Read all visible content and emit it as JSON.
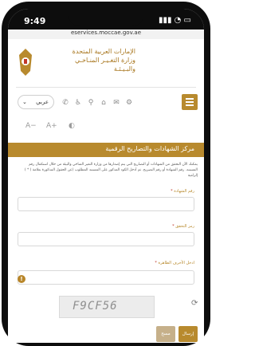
{
  "status_bar": {
    "time": "9:49",
    "url": "eservices.moccae.gov.ae"
  },
  "header": {
    "ministry_line1": "الإمارات العربية المتحدة",
    "ministry_line2": "وزارة التغـيـر المنـاخـي",
    "ministry_line3": "والبـيـئـة"
  },
  "toolbar": {
    "language": "عربي",
    "icons": [
      "phone-icon",
      "accessibility-icon",
      "wheelchair-icon",
      "home-icon",
      "mail-icon",
      "settings-icon",
      "menu-icon"
    ]
  },
  "font_controls": {
    "decrease": "A−",
    "increase": "A+"
  },
  "section": {
    "title": "مركز الشهادات والتصاريح الرقمية",
    "intro": "يمكنك الآن التحقق من الشهادات أو التصاريح التي يتم إصدارها من وزارة التغير المناخي والبيئة من خلال استكمال رقم المستند. رقم الشهادة أو رقم التصريح. ثم أدخل الكود المذكور على المستند المطلوب (عن الحقول المذكورة بعلامة ( * ) إلزامية"
  },
  "form": {
    "certificate_number_label": "رقم الشهادة",
    "type_label": "رمز التحقق",
    "captcha_label": "ادخل الأحرف الظاهرة",
    "required_mark": "*",
    "captcha_value": "F9CF56"
  },
  "buttons": {
    "submit": "إرسال",
    "clear": "مسح"
  },
  "colors": {
    "accent": "#b88a2e",
    "ministry_text": "#a8761e"
  }
}
